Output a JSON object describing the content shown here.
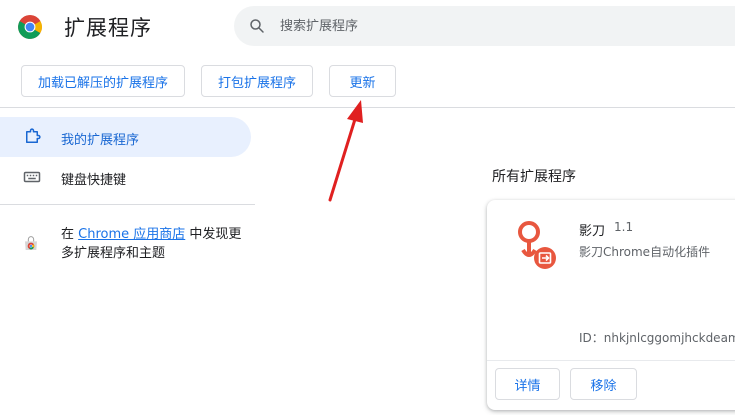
{
  "header": {
    "title": "扩展程序",
    "search_placeholder": "搜索扩展程序"
  },
  "toolbar": {
    "load_unpacked": "加载已解压的扩展程序",
    "pack": "打包扩展程序",
    "update": "更新"
  },
  "sidebar": {
    "items": [
      {
        "label": "我的扩展程序",
        "icon": "puzzle-icon",
        "active": true
      },
      {
        "label": "键盘快捷键",
        "icon": "keyboard-icon",
        "active": false
      }
    ],
    "store": {
      "prefix": "在 ",
      "link": "Chrome 应用商店",
      "suffix": " 中发现更多扩展程序和主题"
    }
  },
  "main": {
    "section_title": "所有扩展程序",
    "extension": {
      "name": "影刀",
      "version": "1.1",
      "description": "影刀Chrome自动化插件",
      "id_label": "ID：nhkjnlcggomjhckdeam",
      "details_label": "详情",
      "remove_label": "移除"
    }
  },
  "colors": {
    "accent": "#1a73e8",
    "active_bg": "#e8f0fe",
    "ext_icon": "#e8573f",
    "annotation_arrow": "#e02020"
  }
}
